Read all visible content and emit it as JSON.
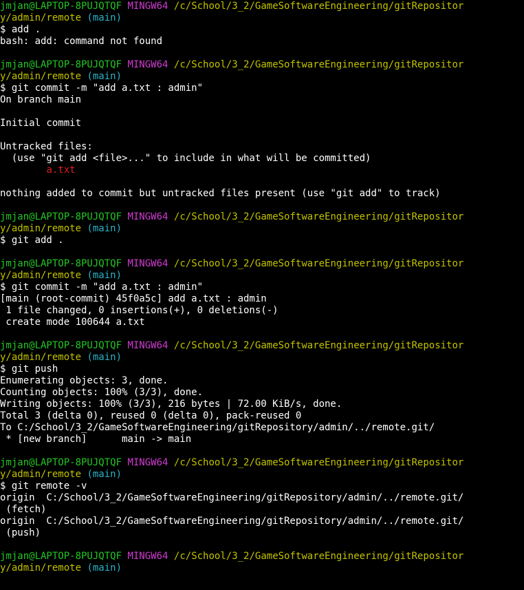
{
  "terminal": {
    "lines": [
      [
        {
          "t": "jmjan@LAPTOP-8PUJQTQF",
          "c": "user"
        },
        {
          "t": " ",
          "c": "out"
        },
        {
          "t": "MINGW64",
          "c": "env"
        },
        {
          "t": " ",
          "c": "out"
        },
        {
          "t": "/c/School/3_2/GameSoftwareEngineering/gitRepositor",
          "c": "path"
        }
      ],
      [
        {
          "t": "y/admin/remote",
          "c": "path"
        },
        {
          "t": " (main)",
          "c": "branch"
        }
      ],
      [
        {
          "t": "$ add .",
          "c": "out"
        }
      ],
      [
        {
          "t": "bash: add: command not found",
          "c": "out"
        }
      ],
      [],
      [
        {
          "t": "jmjan@LAPTOP-8PUJQTQF",
          "c": "user"
        },
        {
          "t": " ",
          "c": "out"
        },
        {
          "t": "MINGW64",
          "c": "env"
        },
        {
          "t": " ",
          "c": "out"
        },
        {
          "t": "/c/School/3_2/GameSoftwareEngineering/gitRepositor",
          "c": "path"
        }
      ],
      [
        {
          "t": "y/admin/remote",
          "c": "path"
        },
        {
          "t": " (main)",
          "c": "branch"
        }
      ],
      [
        {
          "t": "$ git commit -m \"add a.txt : admin\"",
          "c": "out"
        }
      ],
      [
        {
          "t": "On branch main",
          "c": "out"
        }
      ],
      [],
      [
        {
          "t": "Initial commit",
          "c": "out"
        }
      ],
      [],
      [
        {
          "t": "Untracked files:",
          "c": "out"
        }
      ],
      [
        {
          "t": "  (use \"git add <file>...\" to include in what will be committed)",
          "c": "out"
        }
      ],
      [
        {
          "t": "        ",
          "c": "out"
        },
        {
          "t": "a.txt",
          "c": "red"
        }
      ],
      [],
      [
        {
          "t": "nothing added to commit but untracked files present (use \"git add\" to track)",
          "c": "out"
        }
      ],
      [],
      [
        {
          "t": "jmjan@LAPTOP-8PUJQTQF",
          "c": "user"
        },
        {
          "t": " ",
          "c": "out"
        },
        {
          "t": "MINGW64",
          "c": "env"
        },
        {
          "t": " ",
          "c": "out"
        },
        {
          "t": "/c/School/3_2/GameSoftwareEngineering/gitRepositor",
          "c": "path"
        }
      ],
      [
        {
          "t": "y/admin/remote",
          "c": "path"
        },
        {
          "t": " (main)",
          "c": "branch"
        }
      ],
      [
        {
          "t": "$ git add .",
          "c": "out"
        }
      ],
      [],
      [
        {
          "t": "jmjan@LAPTOP-8PUJQTQF",
          "c": "user"
        },
        {
          "t": " ",
          "c": "out"
        },
        {
          "t": "MINGW64",
          "c": "env"
        },
        {
          "t": " ",
          "c": "out"
        },
        {
          "t": "/c/School/3_2/GameSoftwareEngineering/gitRepositor",
          "c": "path"
        }
      ],
      [
        {
          "t": "y/admin/remote",
          "c": "path"
        },
        {
          "t": " (main)",
          "c": "branch"
        }
      ],
      [
        {
          "t": "$ git commit -m \"add a.txt : admin\"",
          "c": "out"
        }
      ],
      [
        {
          "t": "[main (root-commit) 45f0a5c] add a.txt : admin",
          "c": "out"
        }
      ],
      [
        {
          "t": " 1 file changed, 0 insertions(+), 0 deletions(-)",
          "c": "out"
        }
      ],
      [
        {
          "t": " create mode 100644 a.txt",
          "c": "out"
        }
      ],
      [],
      [
        {
          "t": "jmjan@LAPTOP-8PUJQTQF",
          "c": "user"
        },
        {
          "t": " ",
          "c": "out"
        },
        {
          "t": "MINGW64",
          "c": "env"
        },
        {
          "t": " ",
          "c": "out"
        },
        {
          "t": "/c/School/3_2/GameSoftwareEngineering/gitRepositor",
          "c": "path"
        }
      ],
      [
        {
          "t": "y/admin/remote",
          "c": "path"
        },
        {
          "t": " (main)",
          "c": "branch"
        }
      ],
      [
        {
          "t": "$ git push",
          "c": "out"
        }
      ],
      [
        {
          "t": "Enumerating objects: 3, done.",
          "c": "out"
        }
      ],
      [
        {
          "t": "Counting objects: 100% (3/3), done.",
          "c": "out"
        }
      ],
      [
        {
          "t": "Writing objects: 100% (3/3), 216 bytes | 72.00 KiB/s, done.",
          "c": "out"
        }
      ],
      [
        {
          "t": "Total 3 (delta 0), reused 0 (delta 0), pack-reused 0",
          "c": "out"
        }
      ],
      [
        {
          "t": "To C:/School/3_2/GameSoftwareEngineering/gitRepository/admin/../remote.git/",
          "c": "out"
        }
      ],
      [
        {
          "t": " * [new branch]      main -> main",
          "c": "out"
        }
      ],
      [],
      [
        {
          "t": "jmjan@LAPTOP-8PUJQTQF",
          "c": "user"
        },
        {
          "t": " ",
          "c": "out"
        },
        {
          "t": "MINGW64",
          "c": "env"
        },
        {
          "t": " ",
          "c": "out"
        },
        {
          "t": "/c/School/3_2/GameSoftwareEngineering/gitRepositor",
          "c": "path"
        }
      ],
      [
        {
          "t": "y/admin/remote",
          "c": "path"
        },
        {
          "t": " (main)",
          "c": "branch"
        }
      ],
      [
        {
          "t": "$ git remote -v",
          "c": "out"
        }
      ],
      [
        {
          "t": "origin  C:/School/3_2/GameSoftwareEngineering/gitRepository/admin/../remote.git/",
          "c": "out"
        }
      ],
      [
        {
          "t": " (fetch)",
          "c": "out"
        }
      ],
      [
        {
          "t": "origin  C:/School/3_2/GameSoftwareEngineering/gitRepository/admin/../remote.git/",
          "c": "out"
        }
      ],
      [
        {
          "t": " (push)",
          "c": "out"
        }
      ],
      [],
      [
        {
          "t": "jmjan@LAPTOP-8PUJQTQF",
          "c": "user"
        },
        {
          "t": " ",
          "c": "out"
        },
        {
          "t": "MINGW64",
          "c": "env"
        },
        {
          "t": " ",
          "c": "out"
        },
        {
          "t": "/c/School/3_2/GameSoftwareEngineering/gitRepositor",
          "c": "path"
        }
      ],
      [
        {
          "t": "y/admin/remote",
          "c": "path"
        },
        {
          "t": " (main)",
          "c": "branch"
        }
      ]
    ],
    "prompt_input": {
      "prompt": "$",
      "value": ""
    },
    "colors": {
      "background": "#000000",
      "user": "#22c722",
      "env": "#d13bd1",
      "path": "#c2c200",
      "branch": "#2ab4c8",
      "red": "#e02020",
      "out": "#ffffff"
    }
  }
}
